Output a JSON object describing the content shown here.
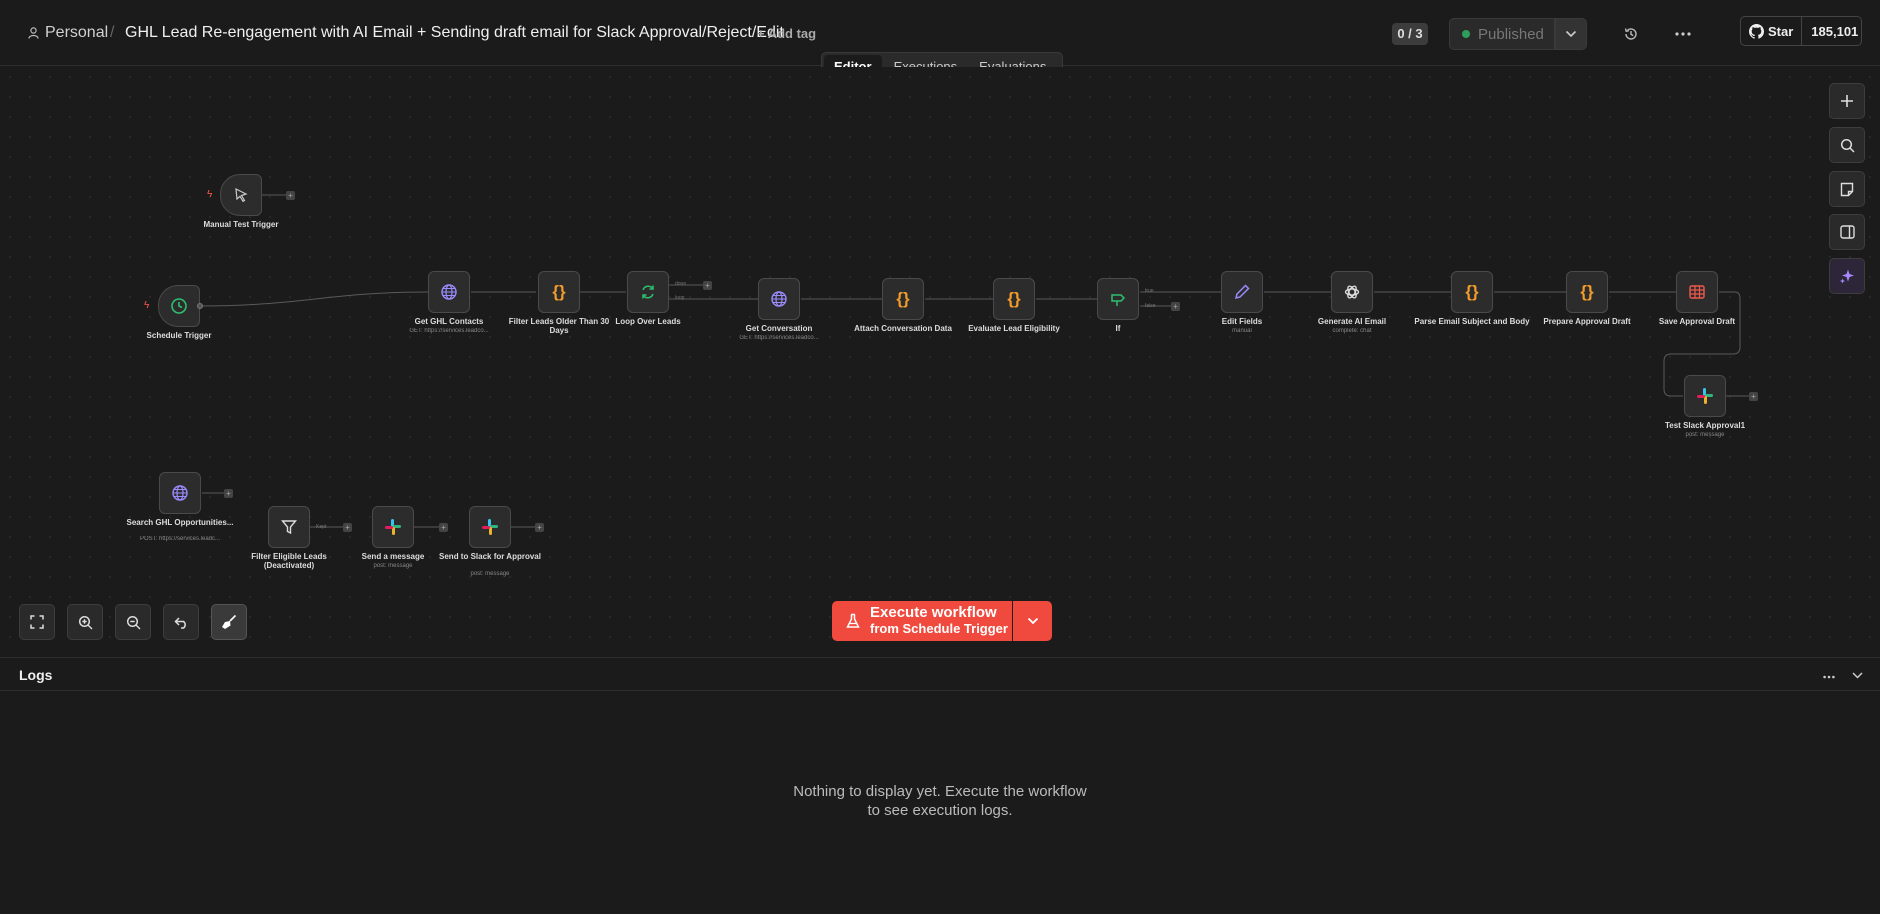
{
  "header": {
    "workspace": "Personal",
    "separator": "/",
    "title": "GHL Lead Re-engagement with AI Email + Sending draft email for Slack Approval/Reject/Edit",
    "add_tag": "+ Add tag",
    "count": "0 / 3",
    "publish_label": "Published",
    "github_star": "Star",
    "github_count": "185,101"
  },
  "tabs": [
    {
      "label": "Editor",
      "active": true
    },
    {
      "label": "Executions",
      "active": false
    },
    {
      "label": "Evaluations",
      "active": false
    }
  ],
  "nodes": {
    "manual_trigger": {
      "label": "Manual Test Trigger",
      "icon": "cursor-icon"
    },
    "schedule_trigger": {
      "label": "Schedule Trigger",
      "icon": "clock-icon"
    },
    "get_ghl_contacts": {
      "label": "Get GHL Contacts",
      "sub": "GET: https://services.leadco...",
      "icon": "globe-icon"
    },
    "filter_leads": {
      "label": "Filter Leads Older Than 30 Days",
      "icon": "code-icon"
    },
    "loop_over_leads": {
      "label": "Loop Over Leads",
      "icon": "loop-icon",
      "branch_done": "done",
      "branch_loop": "loop"
    },
    "get_conversation": {
      "label": "Get Conversation",
      "sub": "GET: https://services.leadco...",
      "icon": "globe-icon"
    },
    "attach_conversation": {
      "label": "Attach Conversation Data",
      "icon": "code-icon"
    },
    "evaluate_lead": {
      "label": "Evaluate Lead Eligibility",
      "icon": "code-icon"
    },
    "if_node": {
      "label": "If",
      "icon": "signpost-icon",
      "branch_true": "true",
      "branch_false": "false"
    },
    "edit_fields": {
      "label": "Edit Fields",
      "sub": "manual",
      "icon": "pencil-icon"
    },
    "generate_ai_email": {
      "label": "Generate AI Email",
      "sub": "complete: chat",
      "icon": "openai-icon"
    },
    "parse_email": {
      "label": "Parse Email Subject and Body",
      "icon": "code-icon"
    },
    "prepare_approval": {
      "label": "Prepare Approval Draft",
      "icon": "code-icon"
    },
    "save_approval": {
      "label": "Save Approval Draft",
      "icon": "table-icon"
    },
    "test_slack": {
      "label": "Test Slack Approval1",
      "sub": "post: message",
      "icon": "slack-icon"
    },
    "search_ghl": {
      "label": "Search GHL Opportunities...",
      "sub": "POST: https://services.leadc...",
      "icon": "globe-icon"
    },
    "filter_eligible": {
      "label": "Filter Eligible Leads (Deactivated)",
      "icon": "filter-icon",
      "branch_kept": "Kept"
    },
    "send_message": {
      "label": "Send a message",
      "sub": "post: message",
      "icon": "slack-icon"
    },
    "send_slack_approval": {
      "label": "Send to Slack for Approval",
      "sub": "post: message",
      "icon": "slack-icon"
    }
  },
  "execute": {
    "title": "Execute workflow",
    "subtitle": "from Schedule Trigger"
  },
  "logs": {
    "title": "Logs",
    "empty": "Nothing to display yet. Execute the workflow to see execution logs."
  },
  "colors": {
    "accent": "#f04a3e",
    "background": "#1b1b1b",
    "node": "#2c2c2c",
    "code_orange": "#f29c2b",
    "globe_purple": "#9a8cff",
    "green": "#2fbf71",
    "table_red": "#ef5a4d"
  }
}
